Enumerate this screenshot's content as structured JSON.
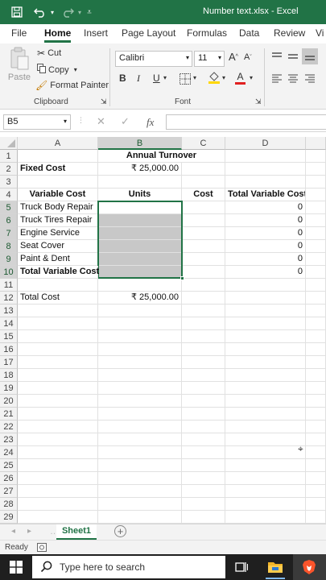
{
  "titlebar": {
    "title": "Number text.xlsx  -  Excel"
  },
  "ribbon_tabs": [
    "File",
    "Home",
    "Insert",
    "Page Layout",
    "Formulas",
    "Data",
    "Review",
    "Vi"
  ],
  "clipboard": {
    "paste": "Paste",
    "cut": "Cut",
    "copy": "Copy",
    "format_painter": "Format Painter",
    "group_label": "Clipboard"
  },
  "font": {
    "name": "Calibri",
    "size": "11",
    "bold": "B",
    "italic": "I",
    "underline": "U",
    "group_label": "Font"
  },
  "formula_bar": {
    "name_box": "B5",
    "fx": "fx",
    "value": ""
  },
  "columns": [
    "A",
    "B",
    "C",
    "D"
  ],
  "rows": [
    "1",
    "2",
    "3",
    "4",
    "5",
    "6",
    "7",
    "8",
    "9",
    "10",
    "11",
    "12",
    "13",
    "14",
    "15",
    "16",
    "17",
    "18",
    "19",
    "20",
    "21",
    "22",
    "23",
    "24",
    "25",
    "26",
    "27",
    "28",
    "29"
  ],
  "cells": {
    "r1": {
      "b": "Annual Turnover"
    },
    "r2": {
      "a": "Fixed Cost",
      "b": "₹ 25,000.00"
    },
    "r4": {
      "a": "Variable Cost",
      "b": "Units",
      "c": "Cost",
      "d": "Total Variable Cost"
    },
    "r5": {
      "a": "Truck Body Repair",
      "d": "0"
    },
    "r6": {
      "a": "Truck Tires Repair",
      "d": "0"
    },
    "r7": {
      "a": "Engine Service",
      "d": "0"
    },
    "r8": {
      "a": "Seat Cover",
      "d": "0"
    },
    "r9": {
      "a": "Paint & Dent",
      "d": "0"
    },
    "r10": {
      "a": "Total Variable Cost",
      "d": "0"
    },
    "r12": {
      "a": "Total Cost",
      "b": "₹ 25,000.00"
    }
  },
  "sheet_tab": "Sheet1",
  "status": "Ready",
  "taskbar": {
    "search_placeholder": "Type here to search"
  },
  "colors": {
    "excel_green": "#217346",
    "selection_fill": "#c8c8c8"
  }
}
